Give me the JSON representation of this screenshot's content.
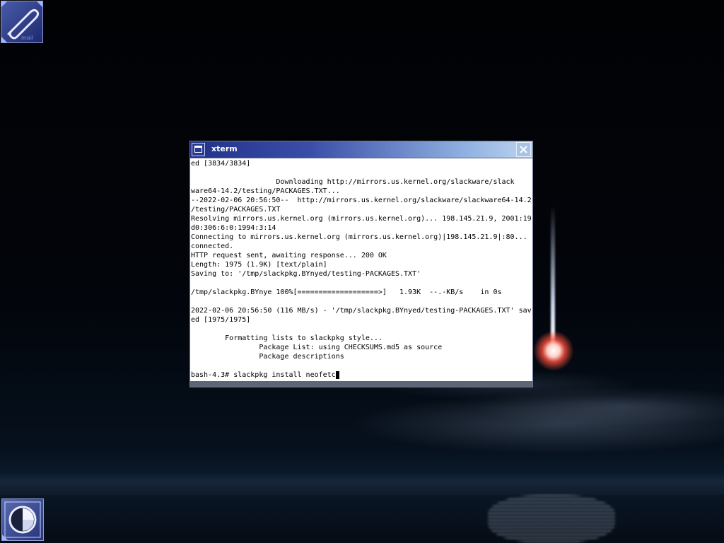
{
  "desktop": {
    "icons": [
      {
        "name": "mail-icon",
        "label": "mail"
      },
      {
        "name": "clock-icon",
        "label": ""
      }
    ]
  },
  "window": {
    "title": "xterm",
    "menu_icon": "window-menu-icon",
    "close_icon": "close-icon"
  },
  "terminal": {
    "lines": [
      "ed [3834/3834]",
      "",
      "                    Downloading http://mirrors.us.kernel.org/slackware/slack",
      "ware64-14.2/testing/PACKAGES.TXT...",
      "--2022-02-06 20:56:50--  http://mirrors.us.kernel.org/slackware/slackware64-14.2",
      "/testing/PACKAGES.TXT",
      "Resolving mirrors.us.kernel.org (mirrors.us.kernel.org)... 198.145.21.9, 2001:19",
      "d0:306:6:0:1994:3:14",
      "Connecting to mirrors.us.kernel.org (mirrors.us.kernel.org)|198.145.21.9|:80...",
      "connected.",
      "HTTP request sent, awaiting response... 200 OK",
      "Length: 1975 (1.9K) [text/plain]",
      "Saving to: '/tmp/slackpkg.BYnyed/testing-PACKAGES.TXT'",
      "",
      "/tmp/slackpkg.BYnye 100%[===================>]   1.93K  --.-KB/s    in 0s",
      "",
      "2022-02-06 20:56:50 (116 MB/s) - '/tmp/slackpkg.BYnyed/testing-PACKAGES.TXT' sav",
      "ed [1975/1975]",
      "",
      "        Formatting lists to slackpkg style...",
      "                Package List: using CHECKSUMS.md5 as source",
      "                Package descriptions",
      ""
    ],
    "prompt": "bash-4.3# slackpkg install neofetc"
  }
}
